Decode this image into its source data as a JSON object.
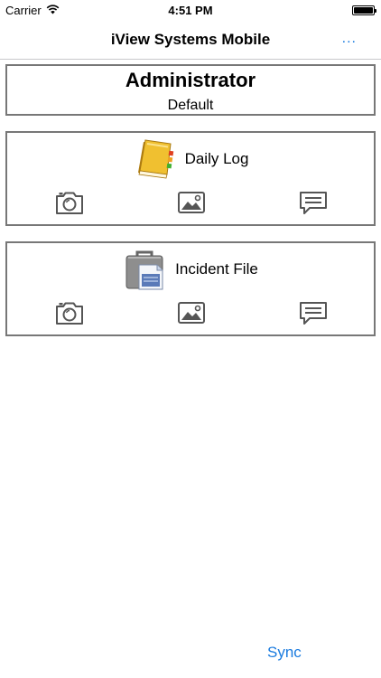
{
  "status_bar": {
    "carrier": "Carrier",
    "time": "4:51 PM",
    "battery_level": 1.0
  },
  "nav": {
    "title": "iView Systems Mobile",
    "more_label": "..."
  },
  "user": {
    "name": "Administrator",
    "profile": "Default"
  },
  "modules": [
    {
      "label": "Daily Log",
      "icon": "daily-log-book-icon"
    },
    {
      "label": "Incident File",
      "icon": "incident-file-briefcase-icon"
    }
  ],
  "actions": [
    "camera-icon",
    "photo-icon",
    "comment-icon"
  ],
  "footer": {
    "sync_label": "Sync"
  },
  "colors": {
    "accent": "#1a7bdf",
    "card_border": "#777777",
    "icon_gray": "#555555",
    "book_gold": "#e8b820"
  }
}
